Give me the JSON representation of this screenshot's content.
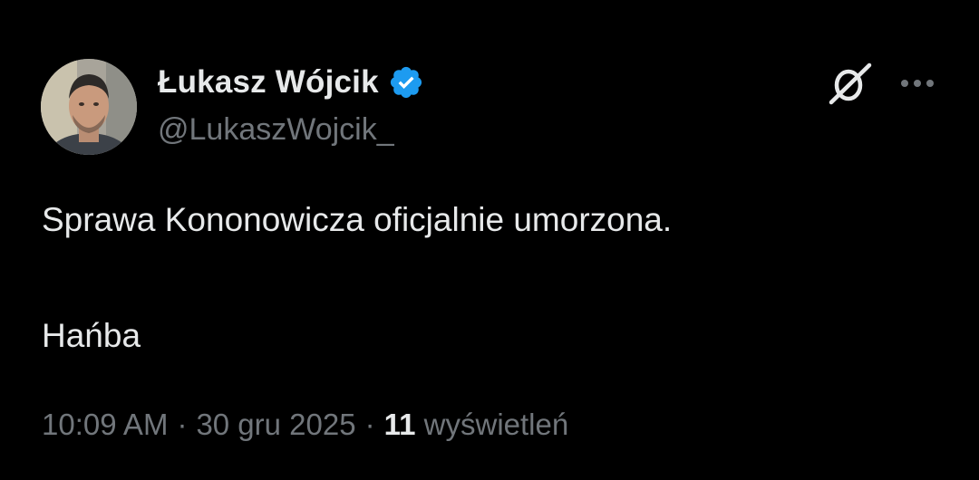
{
  "author": {
    "display_name": "Łukasz Wójcik",
    "handle": "@LukaszWojcik_",
    "verified": true,
    "verified_color": "#1d9bf0"
  },
  "header_actions": {
    "grok_icon": "grok-icon",
    "more_icon": "more-dots-icon"
  },
  "tweet": {
    "lines": [
      "Sprawa Kononowicza oficjalnie umorzona.",
      "Hańba"
    ]
  },
  "meta": {
    "time": "10:09 AM",
    "separator": "·",
    "date": "30 gru 2025",
    "views_count": "11",
    "views_label": "wyświetleń"
  },
  "colors": {
    "background": "#000000",
    "primary_text": "#e7e9ea",
    "secondary_text": "#71767b"
  }
}
